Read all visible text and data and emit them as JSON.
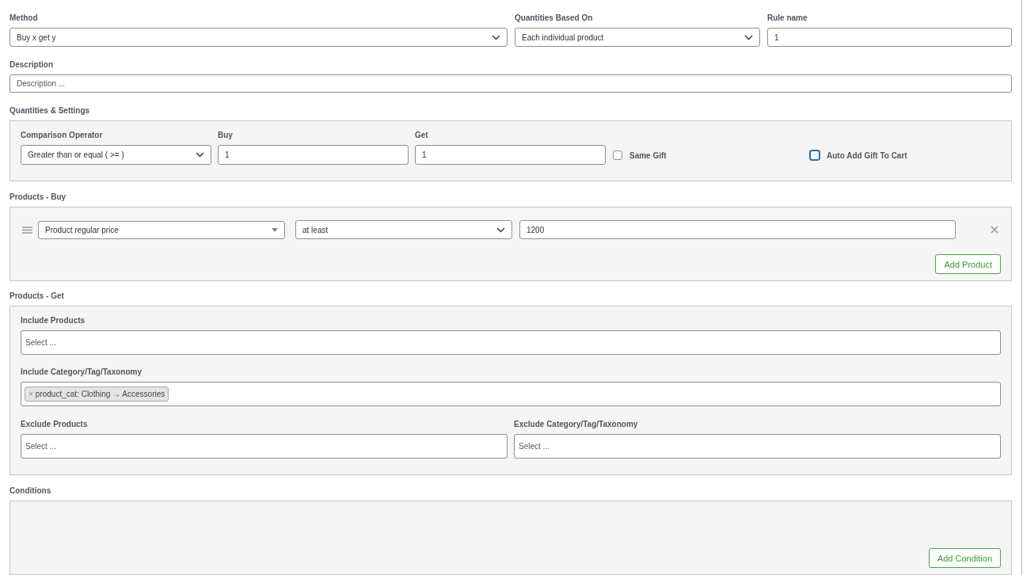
{
  "top_fields": [
    {
      "kind": "select",
      "label": "Method",
      "value": "Buy x get y"
    },
    {
      "kind": "select",
      "label": "Quantities Based On",
      "value": "Each individual product"
    },
    {
      "kind": "text",
      "label": "Rule name",
      "value": "1"
    }
  ],
  "description": {
    "label": "Description",
    "placeholder": "Description ..."
  },
  "quantities": {
    "title": "Quantities & Settings",
    "fields": [
      {
        "kind": "select",
        "label": "Comparison Operator",
        "value": "Greater than or equal ( >= )"
      },
      {
        "kind": "text",
        "label": "Buy",
        "value": "1"
      },
      {
        "kind": "text",
        "label": "Get",
        "value": "1"
      }
    ],
    "checkboxes": [
      {
        "label": "Same Gift",
        "checked": false,
        "focused": false
      },
      {
        "label": "Auto Add Gift To Cart",
        "checked": false,
        "focused": true
      }
    ]
  },
  "products_buy": {
    "title": "Products - Buy",
    "rows": [
      {
        "type": "Product regular price",
        "operator": "at least",
        "value": "1200"
      }
    ],
    "add_button": "Add Product"
  },
  "products_get": {
    "title": "Products - Get",
    "include_products": {
      "label": "Include Products",
      "placeholder": "Select ..."
    },
    "include_taxonomy": {
      "label": "Include Category/Tag/Taxonomy",
      "tags": [
        {
          "remove": "×",
          "text": "product_cat: Clothing → Accessories"
        }
      ]
    },
    "exclude_products": {
      "label": "Exclude Products",
      "placeholder": "Select ..."
    },
    "exclude_taxonomy": {
      "label": "Exclude Category/Tag/Taxonomy",
      "placeholder": "Select ..."
    }
  },
  "conditions": {
    "title": "Conditions",
    "add_button": "Add Condition"
  }
}
